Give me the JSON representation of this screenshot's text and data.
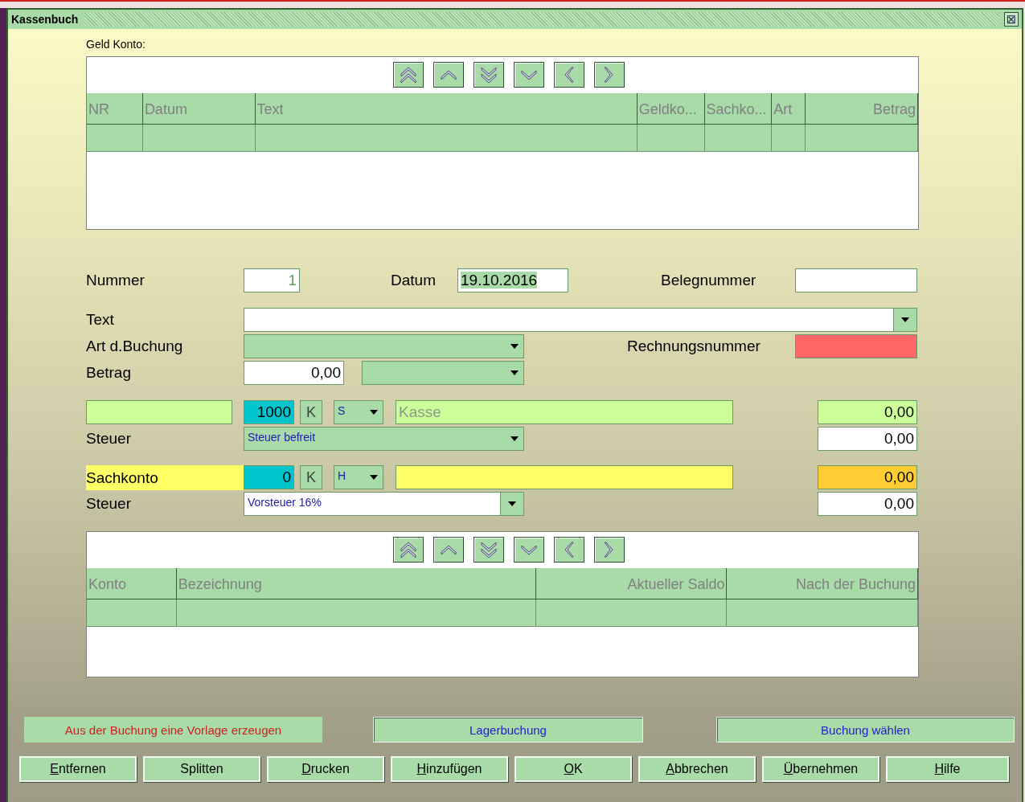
{
  "window": {
    "title": "Kassenbuch",
    "close_button": "⊠"
  },
  "geld_konto": {
    "label": "Geld Konto:",
    "nav_buttons": [
      {
        "kind": "first"
      },
      {
        "kind": "prev"
      },
      {
        "kind": "last"
      },
      {
        "kind": "next"
      },
      {
        "kind": "back"
      },
      {
        "kind": "forward"
      }
    ],
    "columns": [
      {
        "label": "NR",
        "kind": "text"
      },
      {
        "label": "Datum",
        "kind": "text"
      },
      {
        "label": "Text",
        "kind": "text"
      },
      {
        "label": "Geldko...",
        "kind": "text"
      },
      {
        "label": "Sachko...",
        "kind": "text"
      },
      {
        "label": "Art",
        "kind": "text"
      },
      {
        "label": "Betrag",
        "kind": "number"
      }
    ]
  },
  "form": {
    "nummer": {
      "label": "Nummer",
      "value": "1",
      "disabled": true
    },
    "datum": {
      "label": "Datum",
      "value": "19.10.2016",
      "selected": true
    },
    "belegnummer": {
      "label": "Belegnummer"
    },
    "text": {
      "label": "Text"
    },
    "art": {
      "label": "Art d.Buchung"
    },
    "rechnungsnummer": {
      "label": "Rechnungsnummer",
      "invalid": true
    },
    "betrag": {
      "label": "Betrag",
      "value": "0,00"
    },
    "geldkonto": {
      "account": "1000",
      "k_button": "K",
      "side": "S",
      "name": "Kasse",
      "amount": "0,00"
    },
    "geld_steuer": {
      "label": "Steuer",
      "option": "Steuer befreit",
      "amount": "0,00"
    },
    "sachkonto": {
      "label": "Sachkonto",
      "account": "0",
      "k_button": "K",
      "side": "H",
      "amount": "0,00"
    },
    "sach_steuer": {
      "label": "Steuer",
      "option": "Vorsteuer 16%",
      "amount": "0,00"
    }
  },
  "konten": {
    "nav_buttons": [
      {
        "kind": "first"
      },
      {
        "kind": "prev"
      },
      {
        "kind": "last"
      },
      {
        "kind": "next"
      },
      {
        "kind": "back"
      },
      {
        "kind": "forward"
      }
    ],
    "columns": [
      {
        "label": "Konto",
        "kind": "text"
      },
      {
        "label": "Bezeichnung",
        "kind": "text"
      },
      {
        "label": "Aktueller Saldo",
        "kind": "number"
      },
      {
        "label": "Nach der Buchung",
        "kind": "number"
      }
    ]
  },
  "action_buttons": [
    {
      "label": "Aus der Buchung eine Vorlage erzeugen",
      "kind": "warning"
    },
    {
      "label": "Lagerbuchung",
      "kind": "link"
    },
    {
      "label": "Buchung wählen",
      "kind": "link"
    }
  ],
  "footer_buttons": [
    {
      "label": "Entfernen",
      "mnemonic": true
    },
    {
      "label": "Splitten",
      "mnemonic": false
    },
    {
      "label": "Drucken",
      "mnemonic": true
    },
    {
      "label": "Hinzufügen",
      "mnemonic": true
    },
    {
      "label": "OK",
      "mnemonic": true
    },
    {
      "label": "Abbrechen",
      "mnemonic": true
    },
    {
      "label": "Übernehmen",
      "mnemonic": true
    },
    {
      "label": "Hilfe",
      "mnemonic": true
    }
  ]
}
